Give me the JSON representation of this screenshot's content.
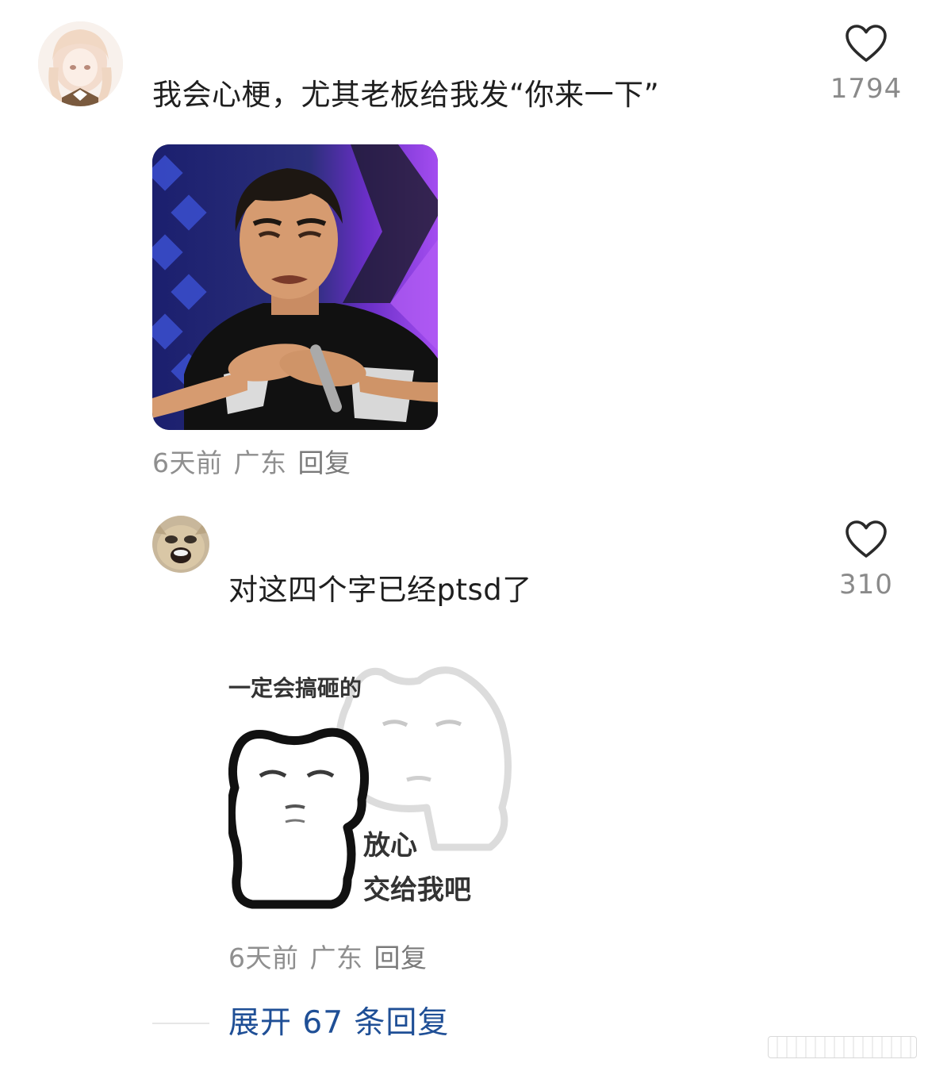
{
  "comments": [
    {
      "text": "我会心梗，尤其老板给我发“你来一下”",
      "likes": "1794",
      "time": "6天前",
      "location": "广东",
      "reply_label": "回复",
      "image_desc_icon": "meme-crying-man"
    },
    {
      "text": "对这四个字已经ptsd了",
      "likes": "310",
      "time": "6天前",
      "location": "广东",
      "reply_label": "回复",
      "sticker": {
        "top_text": "一定会搞砸的",
        "line1": "放心",
        "line2": "交给我吧"
      }
    }
  ],
  "expand_replies": "展开 67 条回复",
  "colors": {
    "link_blue": "#1f4f96",
    "meta_gray": "#8f8f8f",
    "text": "#1f1f1f"
  },
  "icons": {
    "like": "heart-outline-icon"
  }
}
